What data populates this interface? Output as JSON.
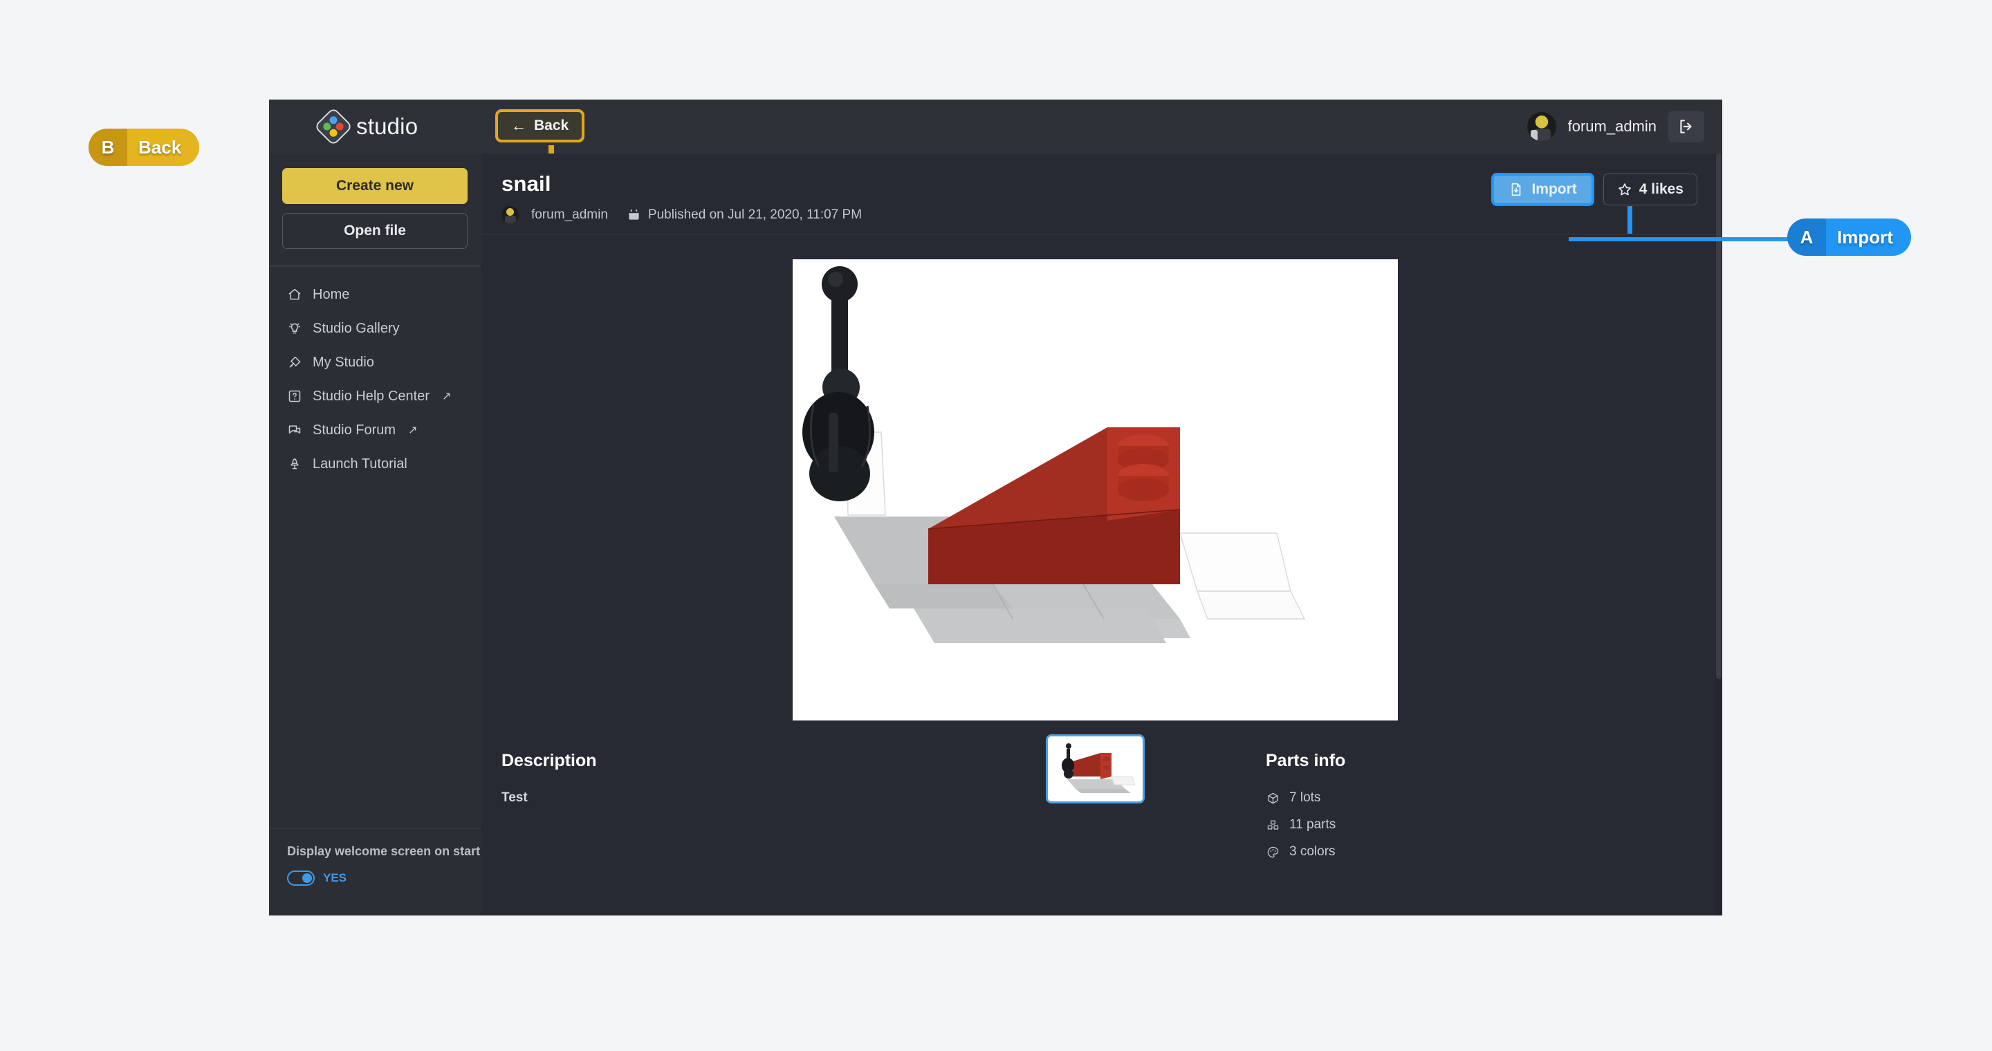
{
  "window": {
    "brand": "studio",
    "back_button": "Back",
    "back_icon": "arrow-left-icon",
    "logo_icon": "studio-diamond-logo-icon"
  },
  "user": {
    "name": "forum_admin",
    "avatar_icon": "minifigure-avatar",
    "logout_icon": "logout-icon"
  },
  "sidebar": {
    "create_new_label": "Create new",
    "open_file_label": "Open file",
    "items": [
      {
        "label": "Home",
        "icon": "home-icon",
        "external": false
      },
      {
        "label": "Studio Gallery",
        "icon": "lightbulb-icon",
        "external": false
      },
      {
        "label": "My Studio",
        "icon": "brush-icon",
        "external": false
      },
      {
        "label": "Studio Help Center",
        "icon": "help-question-icon",
        "external": true
      },
      {
        "label": "Studio Forum",
        "icon": "chat-bubbles-icon",
        "external": true
      },
      {
        "label": "Launch Tutorial",
        "icon": "rocket-icon",
        "external": false
      }
    ],
    "welcome_toggle_label": "Display welcome screen on start",
    "welcome_toggle_state": "YES",
    "welcome_toggle_on": true,
    "external_arrow": "↗"
  },
  "detail": {
    "title": "snail",
    "author": "forum_admin",
    "author_avatar_icon": "minifigure-avatar",
    "date_icon": "calendar-icon",
    "published": "Published on Jul 21, 2020, 11:07 PM",
    "import_label": "Import",
    "import_icon": "file-download-icon",
    "likes_label": "4 likes",
    "likes_icon": "star-icon",
    "thumbnail_name": "model-thumbnail-1"
  },
  "description": {
    "heading": "Description",
    "body": "Test"
  },
  "parts_info": {
    "heading": "Parts info",
    "rows": [
      {
        "label": "7 lots",
        "icon": "cube-icon"
      },
      {
        "label": "11 parts",
        "icon": "bricks-icon"
      },
      {
        "label": "3 colors",
        "icon": "palette-icon"
      }
    ]
  },
  "annotations": [
    {
      "key": "A",
      "label": "Import",
      "color": "#2196f3",
      "key_color": "#1a7fd4"
    },
    {
      "key": "B",
      "label": "Back",
      "color": "#e4b51f",
      "key_color": "#c79612"
    }
  ],
  "colors": {
    "page_background": "#f4f5f7",
    "window_background": "#282a33",
    "topbar": "#2f3138",
    "sidebar": "#2c2e35",
    "accent_yellow": "#e0c349",
    "accent_blue": "#2196f3",
    "highlight_gold": "#e0a91b",
    "viewport_background": "#ffffff",
    "model_red": "#9d2b20",
    "model_grey": "#bfc0c2",
    "model_black": "#1b1c1f"
  }
}
